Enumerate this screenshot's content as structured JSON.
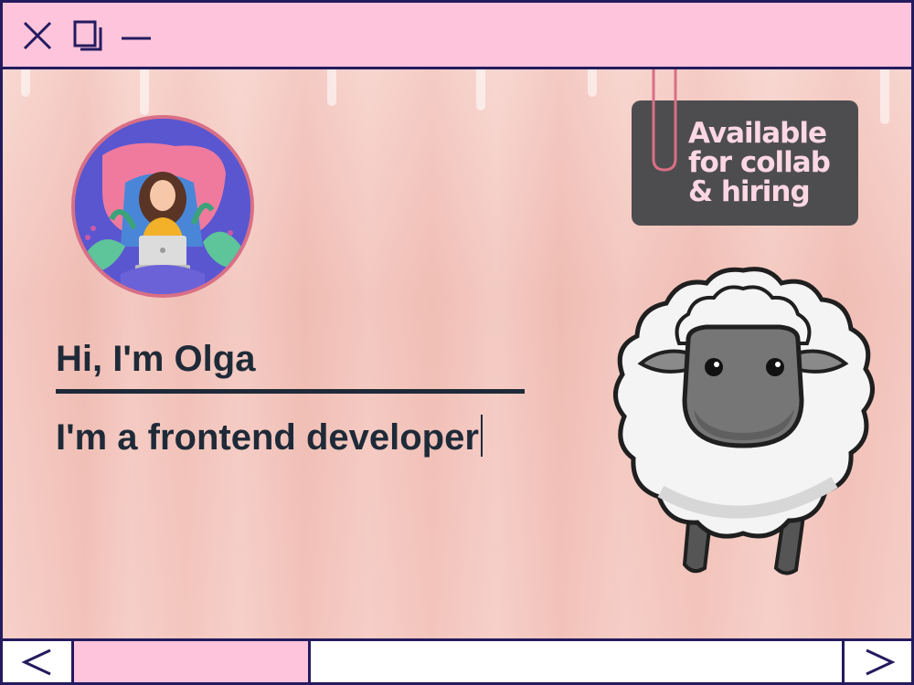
{
  "window": {
    "controls": {
      "close_icon": "close-icon",
      "maximize_icon": "maximize-icon",
      "minimize_icon": "minimize-icon"
    }
  },
  "hero": {
    "greeting": "Hi, I'm Olga",
    "role": "I'm a frontend developer",
    "avatar_icon": "developer-avatar-illustration"
  },
  "badge": {
    "line1": "Available",
    "line2": "for collab",
    "line3": "& hiring"
  },
  "mascot": {
    "icon": "sheep-illustration"
  },
  "scroll": {
    "prev_icon": "chevron-left-icon",
    "next_icon": "chevron-right-icon",
    "position_fraction": 0.08,
    "thumb_fraction": 0.28
  },
  "colors": {
    "frame": "#241b5e",
    "titlebar": "#fdc4dc",
    "text": "#1f2a38",
    "badge_bg": "#4d4d4f",
    "badge_text": "#fdd7e4",
    "background": "#f4c9c0"
  }
}
